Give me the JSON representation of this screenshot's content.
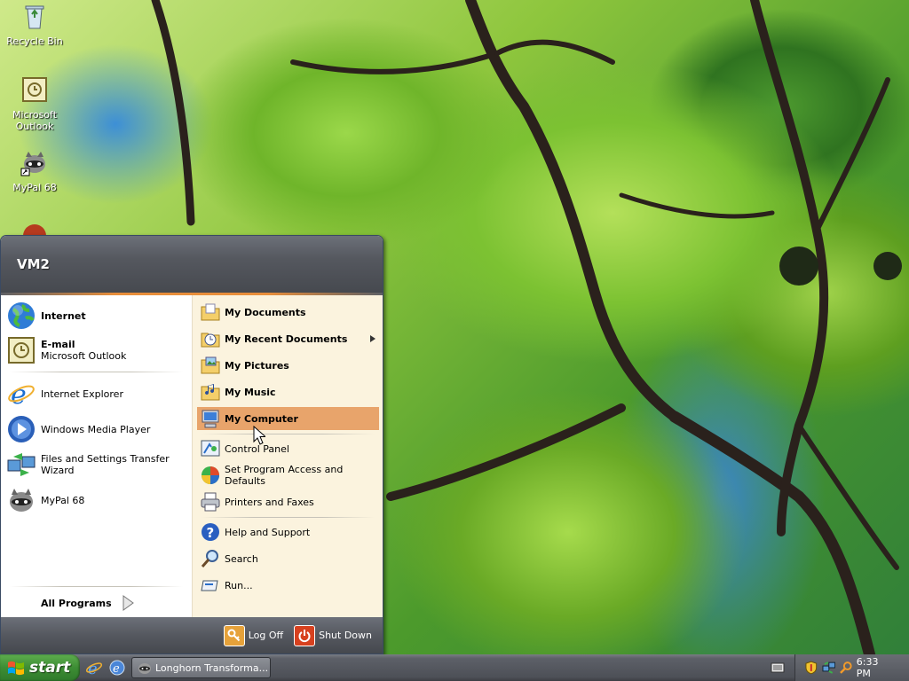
{
  "desktop": {
    "icons": [
      {
        "label": "Recycle Bin",
        "icon": "recycle-bin-icon"
      },
      {
        "label": "Microsoft Outlook",
        "icon": "outlook-icon"
      },
      {
        "label": "MyPal 68",
        "icon": "mypal-raccoon-icon"
      }
    ]
  },
  "start_menu": {
    "user_name": "VM2",
    "pinned": [
      {
        "title": "Internet",
        "subtitle": "",
        "icon": "globe-icon"
      },
      {
        "title": "E-mail",
        "subtitle": "Microsoft Outlook",
        "icon": "outlook-icon"
      }
    ],
    "recent": [
      {
        "label": "Internet Explorer",
        "icon": "internet-explorer-icon"
      },
      {
        "label": "Windows Media Player",
        "icon": "media-player-icon"
      },
      {
        "label": "Files and Settings Transfer Wizard",
        "icon": "transfer-wizard-icon"
      },
      {
        "label": "MyPal 68",
        "icon": "mypal-raccoon-icon"
      }
    ],
    "all_programs": "All Programs",
    "places": [
      {
        "label": "My Documents",
        "icon": "folder-documents-icon"
      },
      {
        "label": "My Recent Documents",
        "icon": "recent-documents-icon"
      },
      {
        "label": "My Pictures",
        "icon": "folder-pictures-icon"
      },
      {
        "label": "My Music",
        "icon": "folder-music-icon"
      },
      {
        "label": "My Computer",
        "icon": "my-computer-icon"
      }
    ],
    "system": [
      {
        "label": "Control Panel",
        "icon": "control-panel-icon"
      },
      {
        "label": "Set Program Access and Defaults",
        "icon": "program-defaults-icon"
      },
      {
        "label": "Printers and Faxes",
        "icon": "printer-icon"
      }
    ],
    "help": [
      {
        "label": "Help and Support",
        "icon": "help-icon"
      },
      {
        "label": "Search",
        "icon": "search-icon"
      },
      {
        "label": "Run...",
        "icon": "run-icon"
      }
    ],
    "log_off": "Log Off",
    "shut_down": "Shut Down"
  },
  "taskbar": {
    "start_label": "start",
    "task_button": "Longhorn Transforma...",
    "clock": "6:33 PM"
  },
  "colors": {
    "highlight": "#e8a46b",
    "start_green": "#3d8d34",
    "menu_header": "#55585f",
    "right_pane": "#fbf3de"
  }
}
